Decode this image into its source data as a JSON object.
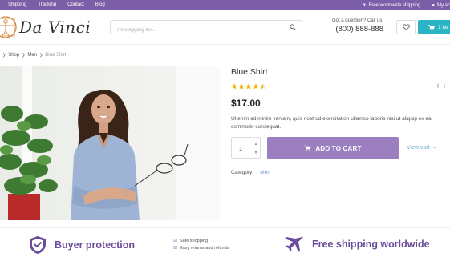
{
  "topbar": {
    "links": [
      "Shipping",
      "Tracking",
      "Contact",
      "Blog"
    ],
    "shipping_note": "Free worldwide shipping",
    "account": "My ac"
  },
  "header": {
    "logo_text": "Da Vinci",
    "search_placeholder": "I'm shopping for...",
    "question": "Got a question? Call us!",
    "phone": "(800) 888-888",
    "cart_label": "1 Ite"
  },
  "breadcrumb": [
    "Shop",
    "Men",
    "Blue Shirt"
  ],
  "product": {
    "name": "Blue Shirt",
    "rating": 4.5,
    "rating_max": 5,
    "price": "$17.00",
    "description": "Ut enim ad minim veniam, quis nostrud exercitation ullamco laboris nisi ut aliquip ex ea commodo consequat.",
    "quantity": "1",
    "add_to_cart": "ADD TO CART",
    "view_cart": "View cart →",
    "category_label": "Category:",
    "category_value": "Men"
  },
  "share_icons": [
    "f",
    "t"
  ],
  "features": {
    "buyer_protection": "Buyer protection",
    "checks": [
      "Safe shopping",
      "Easy returns and refunds"
    ],
    "free_shipping": "Free shipping worldwide"
  },
  "colors": {
    "topbar": "#7b5ea7",
    "accent_purple": "#9b7fc1",
    "feature_purple": "#6b4c9a",
    "cart_teal": "#2bb5c4",
    "star": "#f5b400"
  }
}
